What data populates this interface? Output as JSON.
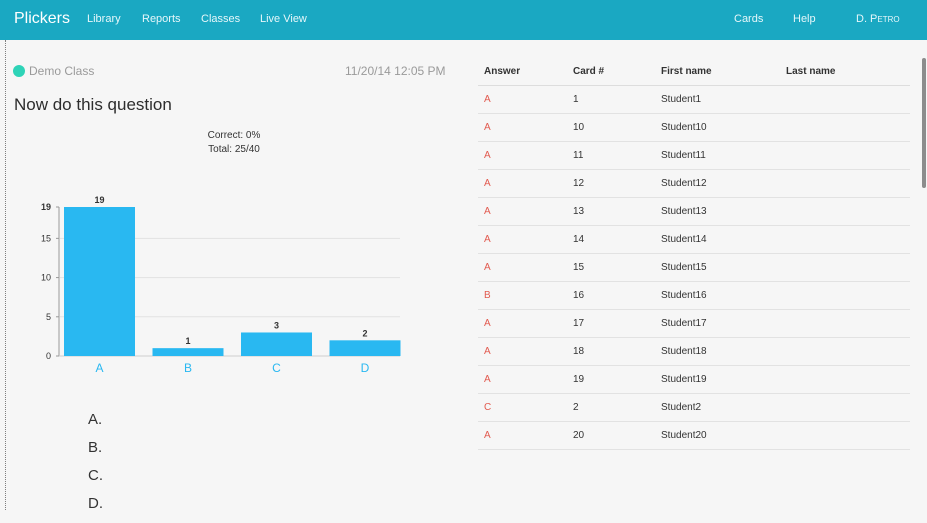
{
  "topbar": {
    "brand": "Plickers",
    "nav": [
      "Library",
      "Reports",
      "Classes",
      "Live View"
    ],
    "right": {
      "cards": "Cards",
      "help": "Help",
      "user": "D. Petro"
    }
  },
  "class_name": "Demo Class",
  "timestamp": "11/20/14 12:05 PM",
  "question_title": "Now do this question",
  "stats": {
    "correct": "Correct: 0%",
    "total": "Total: 25/40"
  },
  "choices": [
    "A.",
    "B.",
    "C.",
    "D."
  ],
  "colors": {
    "bar": "#29b8f1",
    "accent": "#1aa8c2",
    "answer": "#e25a4f",
    "class_dot": "#2ed3b7"
  },
  "chart_data": {
    "type": "bar",
    "categories": [
      "A",
      "B",
      "C",
      "D"
    ],
    "values": [
      19,
      1,
      3,
      2
    ],
    "yticks": [
      0,
      5,
      10,
      15,
      19
    ],
    "ylim": [
      0,
      19
    ],
    "grid": true
  },
  "table": {
    "headers": [
      "Answer",
      "Card #",
      "First name",
      "Last name"
    ],
    "rows": [
      {
        "answer": "A",
        "card": "1",
        "first": "Student1",
        "last": ""
      },
      {
        "answer": "A",
        "card": "10",
        "first": "Student10",
        "last": ""
      },
      {
        "answer": "A",
        "card": "11",
        "first": "Student11",
        "last": ""
      },
      {
        "answer": "A",
        "card": "12",
        "first": "Student12",
        "last": ""
      },
      {
        "answer": "A",
        "card": "13",
        "first": "Student13",
        "last": ""
      },
      {
        "answer": "A",
        "card": "14",
        "first": "Student14",
        "last": ""
      },
      {
        "answer": "A",
        "card": "15",
        "first": "Student15",
        "last": ""
      },
      {
        "answer": "B",
        "card": "16",
        "first": "Student16",
        "last": ""
      },
      {
        "answer": "A",
        "card": "17",
        "first": "Student17",
        "last": ""
      },
      {
        "answer": "A",
        "card": "18",
        "first": "Student18",
        "last": ""
      },
      {
        "answer": "A",
        "card": "19",
        "first": "Student19",
        "last": ""
      },
      {
        "answer": "C",
        "card": "2",
        "first": "Student2",
        "last": ""
      },
      {
        "answer": "A",
        "card": "20",
        "first": "Student20",
        "last": ""
      }
    ]
  }
}
